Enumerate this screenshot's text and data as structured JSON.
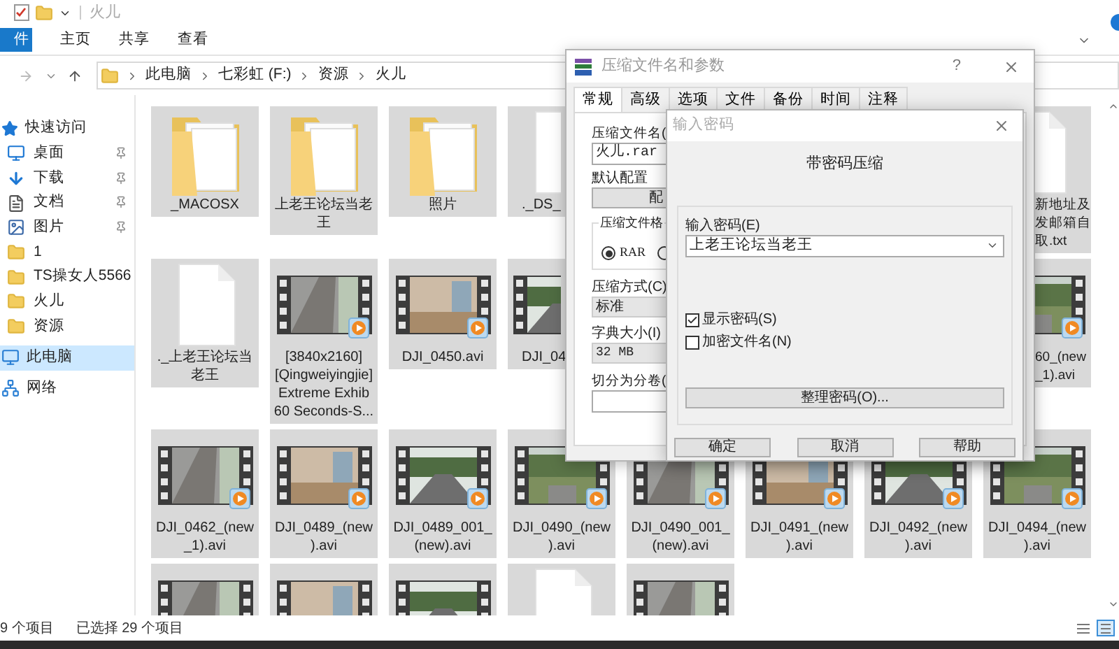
{
  "explorer": {
    "title": "火儿",
    "ribbon_tabs": [
      {
        "label": "件",
        "kind": "file"
      },
      {
        "label": "主页",
        "kind": "tab"
      },
      {
        "label": "共享",
        "kind": "tab"
      },
      {
        "label": "查看",
        "kind": "tab"
      }
    ],
    "breadcrumb": [
      "此电脑",
      "七彩虹 (F:)",
      "资源",
      "火儿"
    ],
    "sidebar": {
      "items": [
        {
          "label": "快速访问",
          "selected": false,
          "children": [
            {
              "label": "桌面",
              "pinned": true,
              "selected": false
            },
            {
              "label": "下载",
              "pinned": true,
              "selected": false
            },
            {
              "label": "文档",
              "pinned": true,
              "selected": false
            },
            {
              "label": "图片",
              "pinned": true,
              "selected": false
            },
            {
              "label": "1",
              "pinned": false,
              "selected": false
            },
            {
              "label": "TS操女人5566",
              "pinned": false,
              "selected": false
            },
            {
              "label": "火儿",
              "pinned": false,
              "selected": false
            },
            {
              "label": "资源",
              "pinned": false,
              "selected": false
            }
          ]
        },
        {
          "label": "此电脑",
          "selected": true
        },
        {
          "label": "网络",
          "selected": false
        }
      ]
    },
    "files": [
      {
        "name": "_MACOSX",
        "kind": "folder",
        "selected": true
      },
      {
        "name": "上老王论坛当老王",
        "kind": "folder",
        "selected": true
      },
      {
        "name": "照片",
        "kind": "folder",
        "selected": true
      },
      {
        "name": "._DS_",
        "kind": "file",
        "selected": true
      },
      {
        "name": "新地址及发邮箱自取.txt",
        "kind": "file",
        "selected": true
      },
      {
        "name": "._上老王论坛当老王",
        "kind": "file",
        "selected": true
      },
      {
        "name": "[3840x2160][Qingweiyingjie] Extreme Exhib 60 Seconds-S...",
        "kind": "video",
        "selected": true
      },
      {
        "name": "DJI_0450.avi",
        "kind": "video",
        "selected": true
      },
      {
        "name": "DJI_04",
        "kind": "video",
        "selected": true
      },
      {
        "name": "60_(new_1).avi",
        "kind": "video",
        "selected": true
      },
      {
        "name": "DJI_0462_(new_1).avi",
        "kind": "video",
        "selected": true
      },
      {
        "name": "DJI_0489_(new).avi",
        "kind": "video",
        "selected": true
      },
      {
        "name": "DJI_0489_001_(new).avi",
        "kind": "video",
        "selected": true
      },
      {
        "name": "DJI_0490_(new).avi",
        "kind": "video",
        "selected": true
      },
      {
        "name": "DJI_0490_001_(new).avi",
        "kind": "video",
        "selected": true
      },
      {
        "name": "DJI_0491_(new).avi",
        "kind": "video",
        "selected": true
      },
      {
        "name": "DJI_0492_(new).avi",
        "kind": "video",
        "selected": true
      },
      {
        "name": "DJI_0494_(new).avi",
        "kind": "video",
        "selected": true
      },
      {
        "kind": "video",
        "selected": true
      },
      {
        "kind": "video",
        "selected": true
      },
      {
        "kind": "video",
        "selected": true
      },
      {
        "kind": "file",
        "selected": true
      },
      {
        "kind": "video",
        "selected": true
      }
    ],
    "status_bar": {
      "count": "9 个项目",
      "selection": "已选择 29 个项目"
    },
    "view_modes": [
      {
        "selected": false
      },
      {
        "selected": true
      }
    ]
  },
  "archive_dialog": {
    "title": "压缩文件名和参数",
    "help_glyph": "?",
    "tabs": [
      {
        "label": "常规",
        "selected": true
      },
      {
        "label": "高级",
        "selected": false
      },
      {
        "label": "选项",
        "selected": false
      },
      {
        "label": "文件",
        "selected": false
      },
      {
        "label": "备份",
        "selected": false
      },
      {
        "label": "时间",
        "selected": false
      },
      {
        "label": "注释",
        "selected": false
      }
    ],
    "archive_name_label": "压缩文件名(",
    "archive_name": "火儿.rar",
    "profile_label": "默认配置",
    "profile_button": "配",
    "format_group": "压缩文件格",
    "formats": [
      {
        "label": "RAR",
        "selected": true
      },
      {
        "selected": false
      }
    ],
    "method_label": "压缩方式(C)",
    "method": "标准",
    "dictionary_label": "字典大小(I)",
    "dictionary": "32 MB",
    "split_label": "切分为分卷("
  },
  "password_dialog": {
    "title": "输入密码",
    "heading": "带密码压缩",
    "password_label": "输入密码(E)",
    "password": "上老王论坛当老王",
    "options": [
      {
        "label": "显示密码(S)",
        "checked": true
      },
      {
        "label": "加密文件名(N)",
        "checked": false
      }
    ],
    "organize_button": "整理密码(O)...",
    "buttons": [
      "确定",
      "取消",
      "帮助"
    ]
  }
}
